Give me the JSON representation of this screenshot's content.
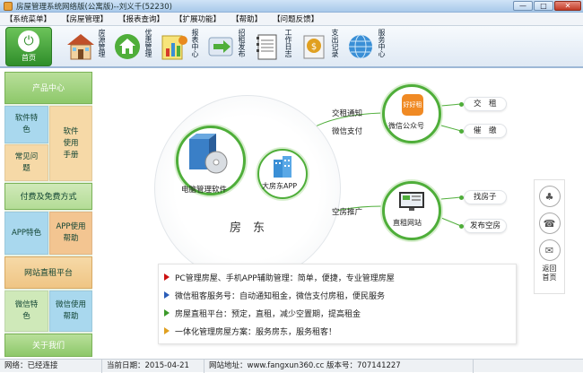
{
  "window": {
    "title": "房屋管理系统网络版(公寓版)--刘义千(52230)",
    "min": "—",
    "max": "□",
    "close": "✕"
  },
  "menu": [
    "【系统菜单】",
    "【房屋管理】",
    "【报表查询】",
    "【扩展功能】",
    "【帮助】",
    "【问题反馈】"
  ],
  "toolbar": {
    "home": "首页",
    "buttons": [
      {
        "label": "房源管理",
        "icon": "house-icon"
      },
      {
        "label": "优惠管理",
        "icon": "recycle-house-icon"
      },
      {
        "label": "报表中心",
        "icon": "report-icon"
      },
      {
        "label": "招租发布",
        "icon": "publish-arrow-icon"
      },
      {
        "label": "工作日志",
        "icon": "notebook-icon"
      },
      {
        "label": "支出记录",
        "icon": "expense-icon"
      },
      {
        "label": "服务中心",
        "icon": "globe-icon"
      }
    ]
  },
  "sidebar": {
    "product_center": "产品中心",
    "software_features": "软件特色",
    "software_manual": "软件使用手册",
    "faq": "常见问题",
    "pay_free": "付费及免费方式",
    "app_features": "APP特色",
    "app_help": "APP使用帮助",
    "website_platform": "网站直租平台",
    "wechat_features": "微信特色",
    "wechat_help": "微信使用帮助",
    "about_us": "关于我们"
  },
  "diagram": {
    "pc_label": "电脑管理软件",
    "app_label": "大房东APP",
    "landlord": "房　东",
    "rent_notice": "交租通知",
    "wechat_pay": "微信支付",
    "wechat_account": "微信公众号",
    "wechat_badge": "好好租",
    "vacancy_promo": "空房推广",
    "website": "直租网站",
    "pill_pay": "交　租",
    "pill_remind": "催　缴",
    "pill_find": "找房子",
    "pill_publish": "发布空房"
  },
  "info": [
    {
      "text": "PC管理房屋、手机APP辅助管理：简单，便捷，专业管理房屋",
      "color": "#cc1111"
    },
    {
      "text": "微信租客服务号：自动通知租金，微信支付房租，便民服务",
      "color": "#2a5db8"
    },
    {
      "text": "房屋直租平台：预定，直租，减少空置期，提高租金",
      "color": "#3c9a2a"
    },
    {
      "text": "一体化管理房屋方案：服务房东，服务租客！",
      "color": "#e0a020"
    }
  ],
  "right_panel": {
    "return_home": "返回首页"
  },
  "status": {
    "network": "网络：已经连接",
    "date": "当前日期：2015-04-21",
    "site": "网站地址：www.fangxun360.cc 版本号：707141227"
  }
}
